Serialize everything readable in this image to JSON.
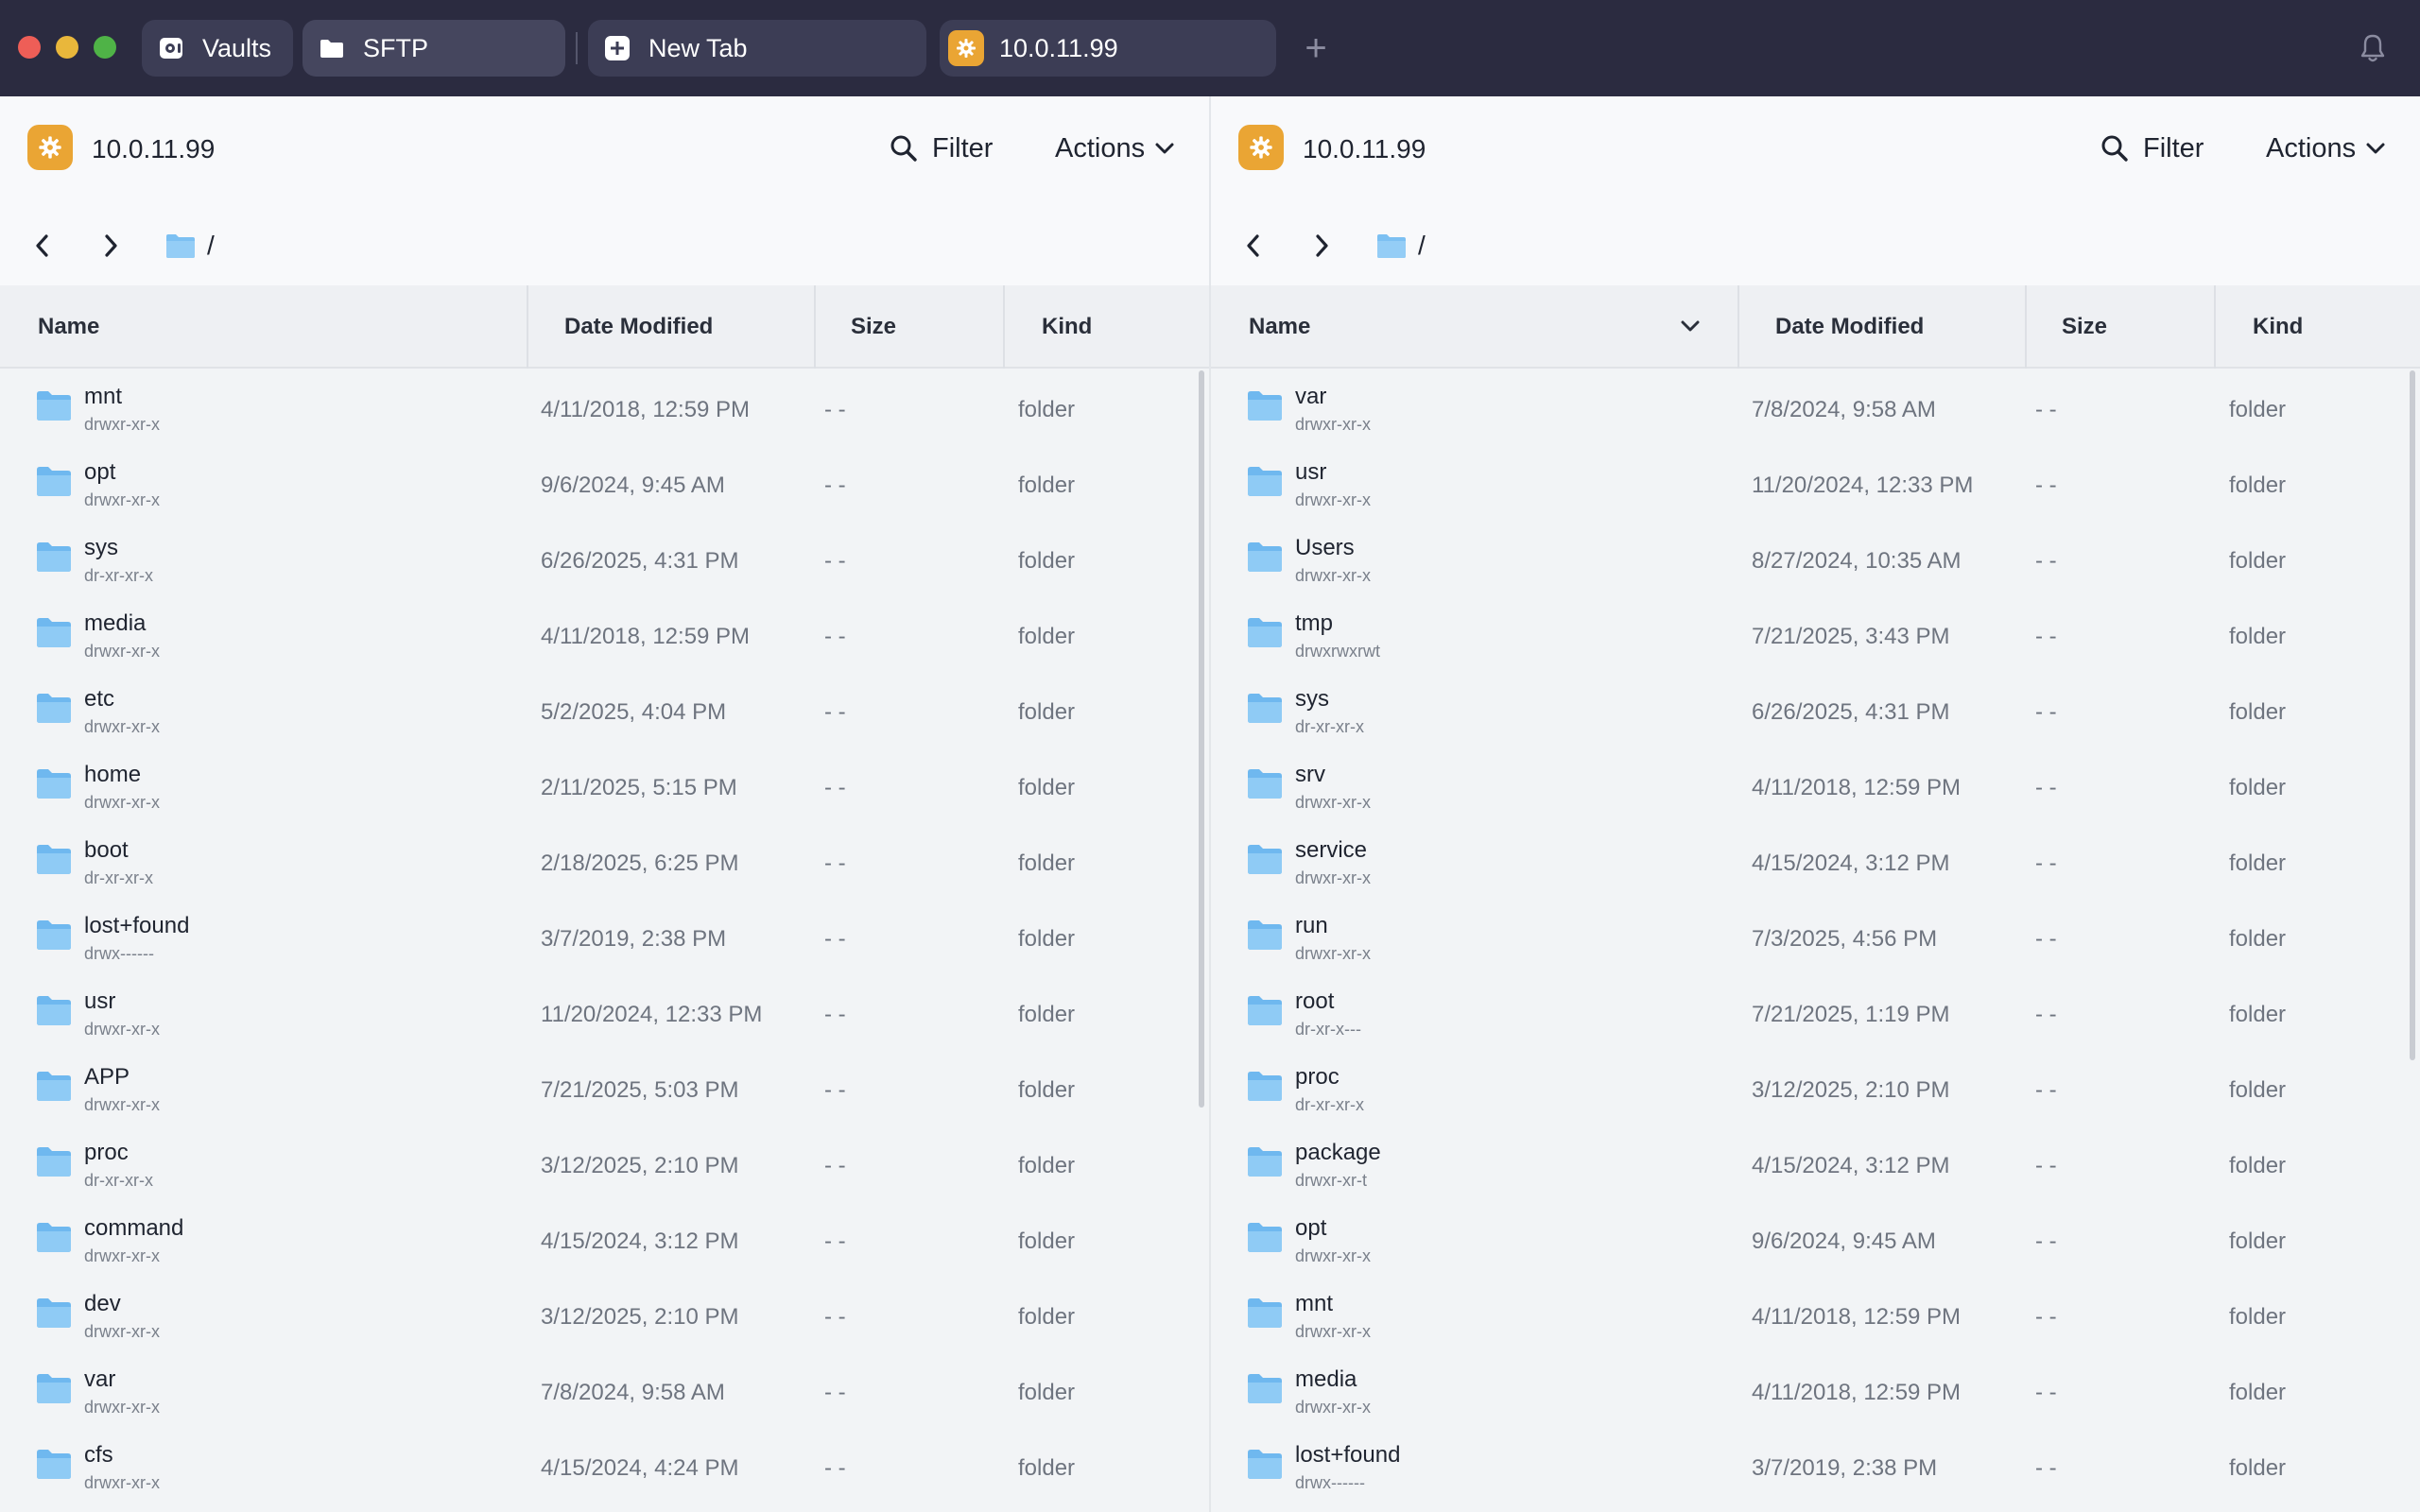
{
  "titlebar": {
    "tabs": [
      {
        "label": "Vaults",
        "icon": "vault-icon"
      },
      {
        "label": "SFTP",
        "icon": "folder-icon"
      },
      {
        "label": "New Tab",
        "icon": "plus-square-icon"
      },
      {
        "label": "10.0.11.99",
        "icon": "host-icon"
      }
    ],
    "add_tab": "+"
  },
  "colors": {
    "titlebar": "#2b2b40",
    "accent": "#eaa534",
    "folder": "#7cc0f2"
  },
  "left": {
    "host": "10.0.11.99",
    "filter_label": "Filter",
    "actions_label": "Actions",
    "path": "/",
    "columns": {
      "name": "Name",
      "date": "Date Modified",
      "size": "Size",
      "kind": "Kind"
    },
    "rows": [
      {
        "name": "mnt",
        "perm": "drwxr-xr-x",
        "date": "4/11/2018, 12:59 PM",
        "size": "- -",
        "kind": "folder"
      },
      {
        "name": "opt",
        "perm": "drwxr-xr-x",
        "date": "9/6/2024, 9:45 AM",
        "size": "- -",
        "kind": "folder"
      },
      {
        "name": "sys",
        "perm": "dr-xr-xr-x",
        "date": "6/26/2025, 4:31 PM",
        "size": "- -",
        "kind": "folder"
      },
      {
        "name": "media",
        "perm": "drwxr-xr-x",
        "date": "4/11/2018, 12:59 PM",
        "size": "- -",
        "kind": "folder"
      },
      {
        "name": "etc",
        "perm": "drwxr-xr-x",
        "date": "5/2/2025, 4:04 PM",
        "size": "- -",
        "kind": "folder"
      },
      {
        "name": "home",
        "perm": "drwxr-xr-x",
        "date": "2/11/2025, 5:15 PM",
        "size": "- -",
        "kind": "folder"
      },
      {
        "name": "boot",
        "perm": "dr-xr-xr-x",
        "date": "2/18/2025, 6:25 PM",
        "size": "- -",
        "kind": "folder"
      },
      {
        "name": "lost+found",
        "perm": "drwx------",
        "date": "3/7/2019, 2:38 PM",
        "size": "- -",
        "kind": "folder"
      },
      {
        "name": "usr",
        "perm": "drwxr-xr-x",
        "date": "11/20/2024, 12:33 PM",
        "size": "- -",
        "kind": "folder"
      },
      {
        "name": "APP",
        "perm": "drwxr-xr-x",
        "date": "7/21/2025, 5:03 PM",
        "size": "- -",
        "kind": "folder"
      },
      {
        "name": "proc",
        "perm": "dr-xr-xr-x",
        "date": "3/12/2025, 2:10 PM",
        "size": "- -",
        "kind": "folder"
      },
      {
        "name": "command",
        "perm": "drwxr-xr-x",
        "date": "4/15/2024, 3:12 PM",
        "size": "- -",
        "kind": "folder"
      },
      {
        "name": "dev",
        "perm": "drwxr-xr-x",
        "date": "3/12/2025, 2:10 PM",
        "size": "- -",
        "kind": "folder"
      },
      {
        "name": "var",
        "perm": "drwxr-xr-x",
        "date": "7/8/2024, 9:58 AM",
        "size": "- -",
        "kind": "folder"
      },
      {
        "name": "cfs",
        "perm": "drwxr-xr-x",
        "date": "4/15/2024, 4:24 PM",
        "size": "- -",
        "kind": "folder"
      }
    ]
  },
  "right": {
    "host": "10.0.11.99",
    "filter_label": "Filter",
    "actions_label": "Actions",
    "path": "/",
    "columns": {
      "name": "Name",
      "date": "Date Modified",
      "size": "Size",
      "kind": "Kind"
    },
    "rows": [
      {
        "name": "var",
        "perm": "drwxr-xr-x",
        "date": "7/8/2024, 9:58 AM",
        "size": "- -",
        "kind": "folder"
      },
      {
        "name": "usr",
        "perm": "drwxr-xr-x",
        "date": "11/20/2024, 12:33 PM",
        "size": "- -",
        "kind": "folder"
      },
      {
        "name": "Users",
        "perm": "drwxr-xr-x",
        "date": "8/27/2024, 10:35 AM",
        "size": "- -",
        "kind": "folder"
      },
      {
        "name": "tmp",
        "perm": "drwxrwxrwt",
        "date": "7/21/2025, 3:43 PM",
        "size": "- -",
        "kind": "folder"
      },
      {
        "name": "sys",
        "perm": "dr-xr-xr-x",
        "date": "6/26/2025, 4:31 PM",
        "size": "- -",
        "kind": "folder"
      },
      {
        "name": "srv",
        "perm": "drwxr-xr-x",
        "date": "4/11/2018, 12:59 PM",
        "size": "- -",
        "kind": "folder"
      },
      {
        "name": "service",
        "perm": "drwxr-xr-x",
        "date": "4/15/2024, 3:12 PM",
        "size": "- -",
        "kind": "folder"
      },
      {
        "name": "run",
        "perm": "drwxr-xr-x",
        "date": "7/3/2025, 4:56 PM",
        "size": "- -",
        "kind": "folder"
      },
      {
        "name": "root",
        "perm": "dr-xr-x---",
        "date": "7/21/2025, 1:19 PM",
        "size": "- -",
        "kind": "folder"
      },
      {
        "name": "proc",
        "perm": "dr-xr-xr-x",
        "date": "3/12/2025, 2:10 PM",
        "size": "- -",
        "kind": "folder"
      },
      {
        "name": "package",
        "perm": "drwxr-xr-t",
        "date": "4/15/2024, 3:12 PM",
        "size": "- -",
        "kind": "folder"
      },
      {
        "name": "opt",
        "perm": "drwxr-xr-x",
        "date": "9/6/2024, 9:45 AM",
        "size": "- -",
        "kind": "folder"
      },
      {
        "name": "mnt",
        "perm": "drwxr-xr-x",
        "date": "4/11/2018, 12:59 PM",
        "size": "- -",
        "kind": "folder"
      },
      {
        "name": "media",
        "perm": "drwxr-xr-x",
        "date": "4/11/2018, 12:59 PM",
        "size": "- -",
        "kind": "folder"
      },
      {
        "name": "lost+found",
        "perm": "drwx------",
        "date": "3/7/2019, 2:38 PM",
        "size": "- -",
        "kind": "folder"
      }
    ]
  }
}
